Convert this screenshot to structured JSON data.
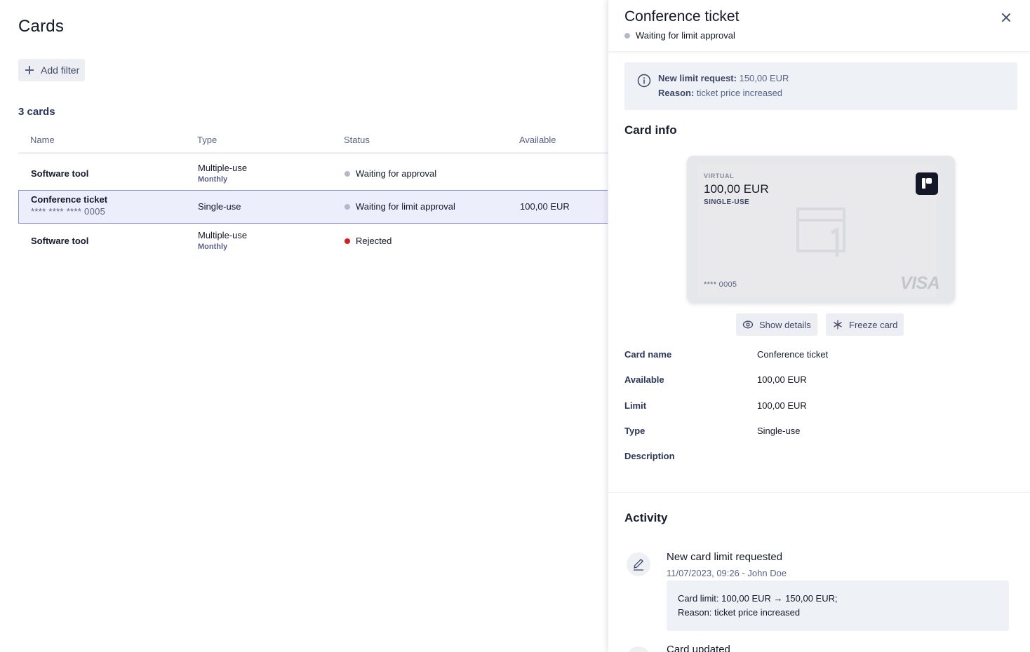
{
  "page": {
    "title": "Cards",
    "add_filter_label": "Add filter",
    "cards_count": "3 cards"
  },
  "table": {
    "columns": [
      "Name",
      "Type",
      "Status",
      "Available"
    ],
    "rows": [
      {
        "name": "Software tool",
        "name_sub": "",
        "type": "Multiple-use",
        "type_sub": "Monthly",
        "status": "Waiting for approval",
        "status_color": "#b4b9c8",
        "available": ""
      },
      {
        "name": "Conference ticket",
        "name_sub": "**** **** **** 0005",
        "type": "Single-use",
        "type_sub": "",
        "status": "Waiting for limit approval",
        "status_color": "#b4b9c8",
        "available": "100,00 EUR"
      },
      {
        "name": "Software tool",
        "name_sub": "",
        "type": "Multiple-use",
        "type_sub": "Monthly",
        "status": "Rejected",
        "status_color": "#d0202a",
        "available": ""
      }
    ]
  },
  "panel": {
    "title": "Conference ticket",
    "status": "Waiting for limit approval",
    "status_color": "#b4b9c8",
    "info": {
      "limit_label": "New limit request:",
      "limit_value": "150,00 EUR",
      "reason_label": "Reason:",
      "reason_value": "ticket price increased"
    },
    "card_info_title": "Card info",
    "card": {
      "kind": "VIRTUAL",
      "amount": "100,00 EUR",
      "use": "SINGLE-USE",
      "pan": "**** 0005",
      "network": "VISA"
    },
    "show_details_label": "Show details",
    "freeze_card_label": "Freeze card",
    "details": [
      {
        "label": "Card name",
        "value": "Conference ticket"
      },
      {
        "label": "Available",
        "value": "100,00 EUR"
      },
      {
        "label": "Limit",
        "value": "100,00 EUR"
      },
      {
        "label": "Type",
        "value": "Single-use"
      },
      {
        "label": "Description",
        "value": ""
      }
    ],
    "activity_title": "Activity",
    "activity": [
      {
        "title": "New card limit requested",
        "meta": "11/07/2023, 09:26 - John Doe",
        "line1": "Card limit: 100,00 EUR → 150,00 EUR;",
        "line2": "Reason: ticket price increased"
      },
      {
        "title": "Card updated"
      }
    ]
  },
  "colors": {
    "accent": "#8a90d8",
    "selected_row_bg": "#edeefb",
    "rejected": "#d0202a",
    "pending": "#b4b9c8"
  },
  "icons": [
    "plus-icon",
    "close-icon",
    "info-icon",
    "eye-icon",
    "snowflake-icon",
    "pencil-icon",
    "brand-logo-icon",
    "card-watermark-icon"
  ]
}
